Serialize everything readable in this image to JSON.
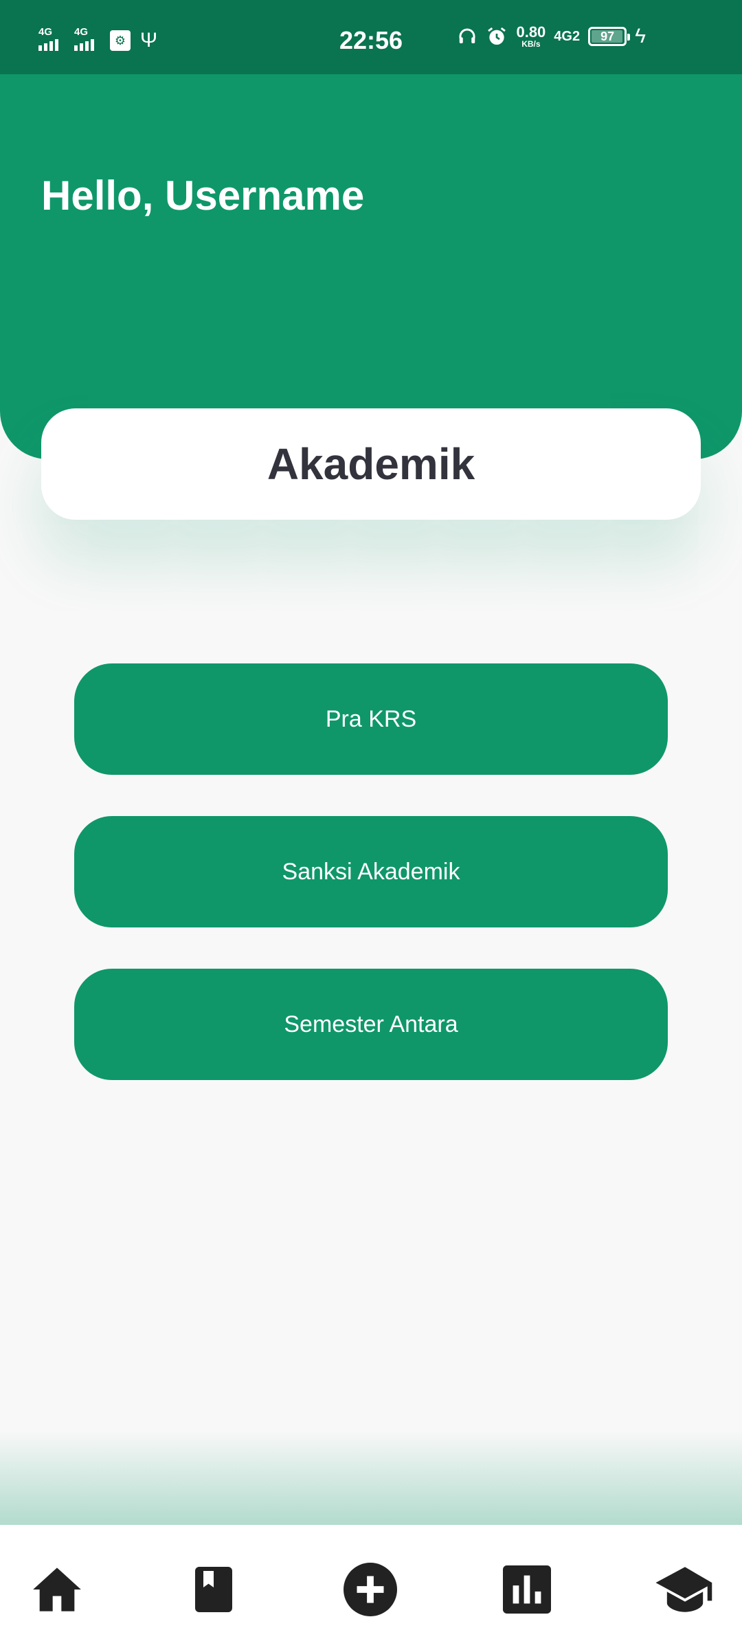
{
  "status_bar": {
    "time": "22:56",
    "signal_1_label": "4G",
    "signal_2_label": "4G",
    "net_speed_value": "0.80",
    "net_speed_unit": "KB/s",
    "network_type": "4G2",
    "battery_percent": "97",
    "battery_level": 0.97,
    "icons": [
      "signal-icon",
      "signal-icon",
      "sim-icon",
      "usb-icon",
      "headphones-icon",
      "alarm-icon",
      "battery-icon",
      "charging-icon"
    ]
  },
  "header": {
    "greeting": "Hello, Username"
  },
  "section": {
    "title": "Akademik"
  },
  "menu": {
    "items": [
      {
        "label": "Pra KRS"
      },
      {
        "label": "Sanksi Akademik"
      },
      {
        "label": "Semester Antara"
      }
    ]
  },
  "bottom_nav": {
    "items": [
      {
        "icon": "home-icon"
      },
      {
        "icon": "bookmark-book-icon"
      },
      {
        "icon": "add-circle-icon"
      },
      {
        "icon": "bar-chart-icon"
      },
      {
        "icon": "graduation-cap-icon"
      }
    ]
  },
  "colors": {
    "status_bar": "#0a7350",
    "primary": "#0f976a",
    "background": "#f8f8f8",
    "card": "#ffffff",
    "title_text": "#33333d",
    "nav_icon": "#222222"
  }
}
